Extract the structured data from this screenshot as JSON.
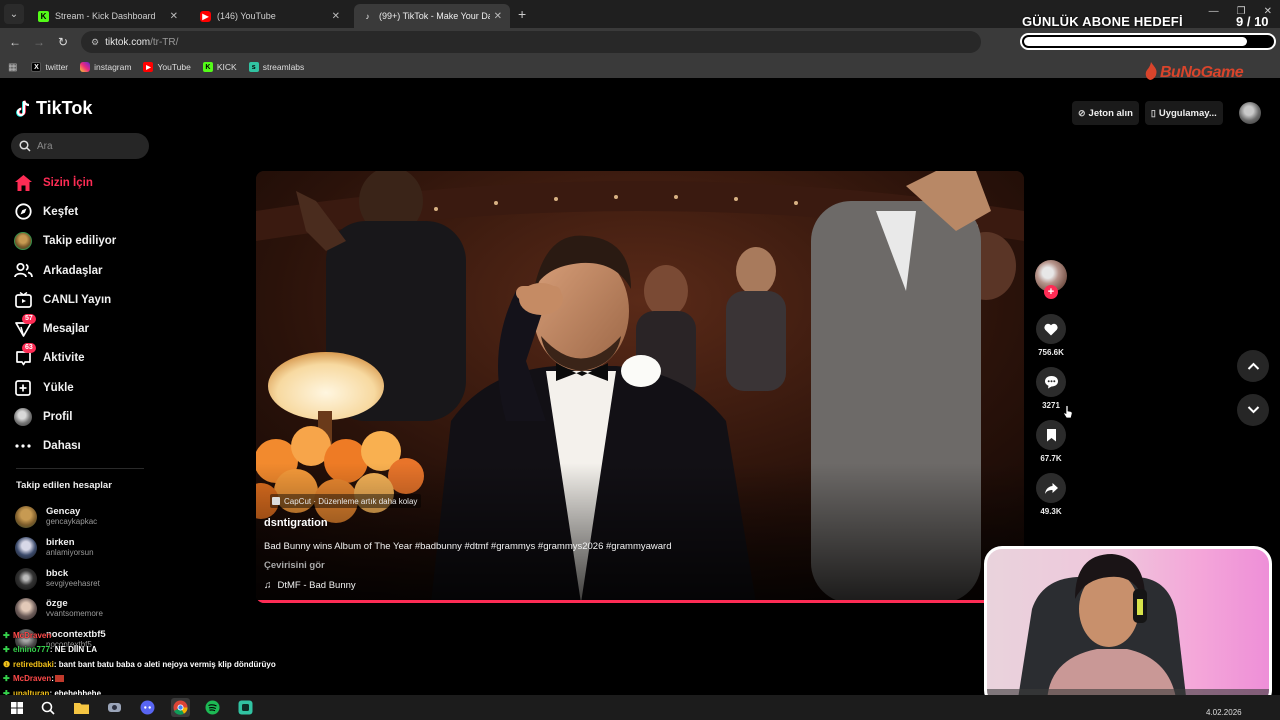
{
  "browser": {
    "tabs": [
      {
        "label": "Stream - Kick Dashboard",
        "favicon": "kick-icon",
        "color": "#53fc18"
      },
      {
        "label": "(146) YouTube",
        "favicon": "youtube-icon",
        "color": "#ff0000"
      },
      {
        "label": "(99+) TikTok - Make Your Da",
        "favicon": "tiktok-icon",
        "color": "#ffffff"
      }
    ],
    "url_host": "tiktok.com",
    "url_path": "/tr-TR/",
    "bookmarks": [
      {
        "label": "twitter",
        "icon": "x-icon",
        "color": "#000000"
      },
      {
        "label": "instagram",
        "icon": "instagram-icon",
        "color": "#e1306c"
      },
      {
        "label": "YouTube",
        "icon": "youtube-icon",
        "color": "#ff0000"
      },
      {
        "label": "KICK",
        "icon": "kick-icon",
        "color": "#53fc18"
      },
      {
        "label": "streamlabs",
        "icon": "streamlabs-icon",
        "color": "#31c3a2"
      }
    ]
  },
  "overlay": {
    "goal_title": "GÜNLÜK ABONE HEDEFİ",
    "goal_count": "9  / 10",
    "goal_progress": 0.9,
    "brand": "BuNoGame"
  },
  "tiktok": {
    "logo": "TikTok",
    "search_placeholder": "Ara",
    "nav": [
      {
        "label": "Sizin İçin",
        "icon": "home-icon",
        "active": true
      },
      {
        "label": "Keşfet",
        "icon": "compass-icon"
      },
      {
        "label": "Takip ediliyor",
        "icon": "following-avatar-icon"
      },
      {
        "label": "Arkadaşlar",
        "icon": "friends-icon"
      },
      {
        "label": "CANLI Yayın",
        "icon": "live-icon"
      },
      {
        "label": "Mesajlar",
        "icon": "messages-icon",
        "badge": "57"
      },
      {
        "label": "Aktivite",
        "icon": "activity-icon",
        "badge": "63"
      },
      {
        "label": "Yükle",
        "icon": "upload-icon"
      },
      {
        "label": "Profil",
        "icon": "profile-avatar-icon"
      },
      {
        "label": "Dahası",
        "icon": "more-icon"
      }
    ],
    "following_header": "Takip edilen hesaplar",
    "following": [
      {
        "name": "Gencay",
        "user": "gencaykapkac",
        "color": "#8a6a3a"
      },
      {
        "name": "birken",
        "user": "anlamiyorsun",
        "color": "#3b4a6b"
      },
      {
        "name": "bbck",
        "user": "sevgiyeehasret",
        "color": "#2a2a2a"
      },
      {
        "name": "özge",
        "user": "vvantsomemore",
        "color": "#6b5b58"
      },
      {
        "name": "nocontextbf5",
        "user": "nocontextbf5",
        "color": "#4a4a4a"
      }
    ],
    "top_buttons": {
      "coins": "Jeton alın",
      "app": "Uygulamay..."
    },
    "video": {
      "capcut_label": "CapCut · Düzenleme artık daha kolay",
      "author": "dsntigration",
      "description": "Bad Bunny wins Album of The Year #badbunny #dtmf #grammys #grammys2026 #grammyaward",
      "translate": "Çevirisini gör",
      "music": "DtMF - Bad Bunny",
      "progress": 0.95
    },
    "actions": {
      "likes": "756.6K",
      "comments": "3271",
      "saves": "67.7K",
      "shares": "49.3K"
    }
  },
  "chat": [
    {
      "badge": "green",
      "user": "McDraven",
      "user_color": "#ff4a4a",
      "msg": ""
    },
    {
      "badge": "green",
      "user": "elnino777",
      "user_color": "#35d14b",
      "msg": " : NE DİİN LA"
    },
    {
      "badge": "yellow",
      "user": "retiredbaki",
      "user_color": "#f2c11a",
      "msg": " : bant bant batu baba o aleti nejoya vermiş klip döndürüyo"
    },
    {
      "badge": "green",
      "user": "McDraven",
      "user_color": "#ff4a4a",
      "msg": " : "
    },
    {
      "badge": "green",
      "user": "unalturan",
      "user_color": "#f2c11a",
      "msg": " : ehehehhehe"
    }
  ],
  "taskbar": {
    "date": "4.02.2026",
    "apps": [
      "windows-start-icon",
      "search-icon",
      "file-explorer-icon",
      "app-icon",
      "discord-icon",
      "chrome-icon",
      "spotify-icon",
      "streamlabs-icon"
    ]
  }
}
